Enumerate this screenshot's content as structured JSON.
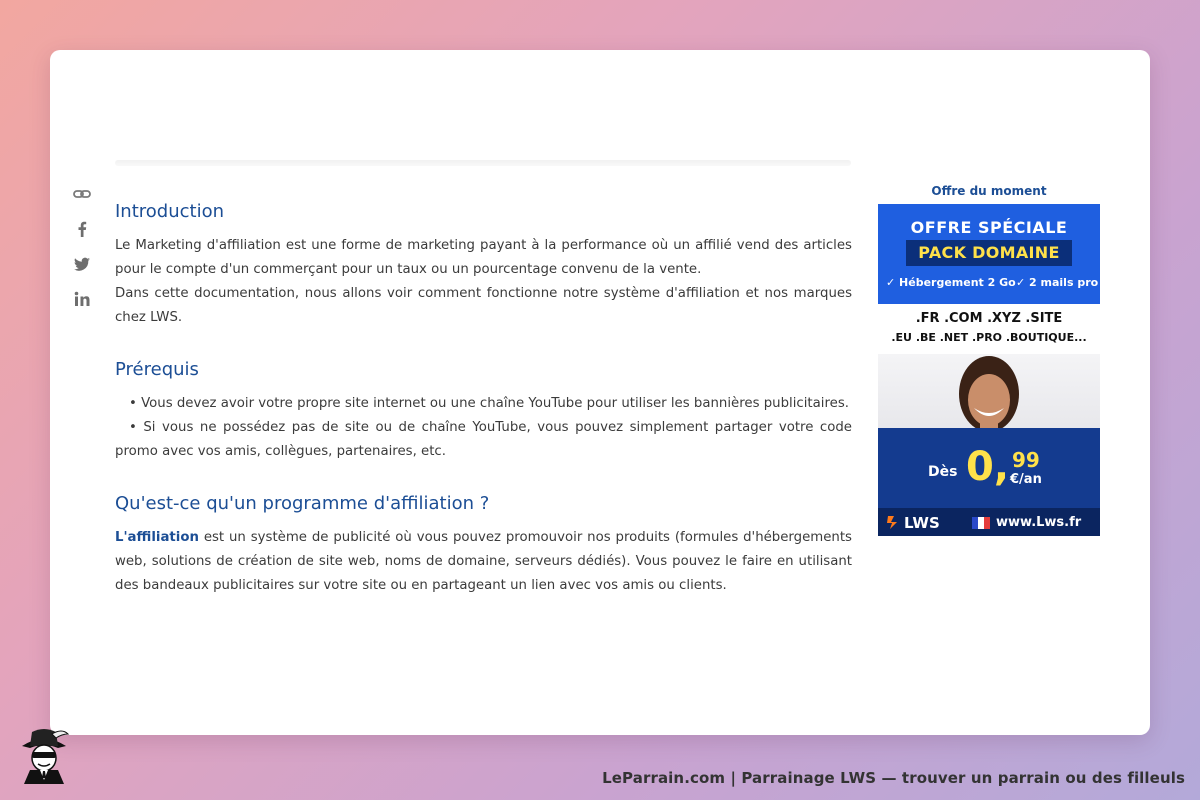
{
  "share": {
    "link": "link-icon",
    "facebook": "facebook-icon",
    "twitter": "twitter-icon",
    "linkedin": "linkedin-icon"
  },
  "article": {
    "intro_title": "Introduction",
    "intro_p1": "Le Marketing d'affiliation est une forme de marketing payant à la performance où un affilié vend des articles pour le compte d'un commerçant pour un taux ou un pourcentage convenu de la vente.",
    "intro_p2": "Dans cette documentation, nous allons voir comment fonctionne notre système d'affiliation et nos marques chez LWS.",
    "prereq_title": "Prérequis",
    "prereq_items": [
      "• Vous devez avoir votre propre site internet ou une chaîne YouTube pour utiliser les bannières publicitaires.",
      "• Si vous ne possédez pas de site ou de chaîne YouTube, vous pouvez simplement partager votre code promo avec vos amis, collègues, partenaires, etc."
    ],
    "program_title": "Qu'est-ce qu'un programme d'affiliation ?",
    "program_strong": "L'affiliation",
    "program_text": " est un système de publicité où vous pouvez promouvoir nos produits (formules d'hébergements web, solutions de création de site web, noms de domaine, serveurs dédiés). Vous pouvez le faire en utilisant des bandeaux publicitaires sur votre site ou en partageant un lien avec vos amis ou clients."
  },
  "sidebar": {
    "title": "Offre du moment",
    "ad": {
      "headline": "OFFRE SPÉCIALE",
      "pack": "PACK DOMAINE",
      "feature1": "✓ Hébergement 2 Go",
      "feature2": "✓ 2 mails pro",
      "domains_line1": ".FR .COM .XYZ .SITE",
      "domains_line2": ".EU .BE .NET .PRO .BOUTIQUE...",
      "price_prefix": "Dès",
      "price_int": "0,",
      "price_cents": "99",
      "price_unit": "€/an",
      "brand": "LWS",
      "url": "www.Lws.fr"
    }
  },
  "footer": {
    "text": "LeParrain.com | Parrainage LWS — trouver un parrain ou des filleuls"
  },
  "colors": {
    "accent": "#1c4e95",
    "ad_blue": "#1f5fe0",
    "ad_yellow": "#ffe14a"
  }
}
